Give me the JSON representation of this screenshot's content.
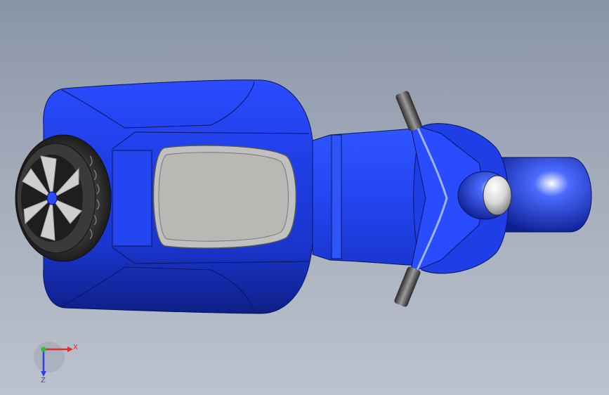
{
  "scene": {
    "model_description_icon": "scooter-model",
    "body_color": "#1f3fe6",
    "background_top": "#8994a6",
    "background_bottom": "#bcc3ce"
  },
  "triad": {
    "x_label": "X",
    "z_label": "Z",
    "x_color": "#e0302a",
    "y_color": "#2fbf2f",
    "z_color": "#2f3fe0"
  }
}
